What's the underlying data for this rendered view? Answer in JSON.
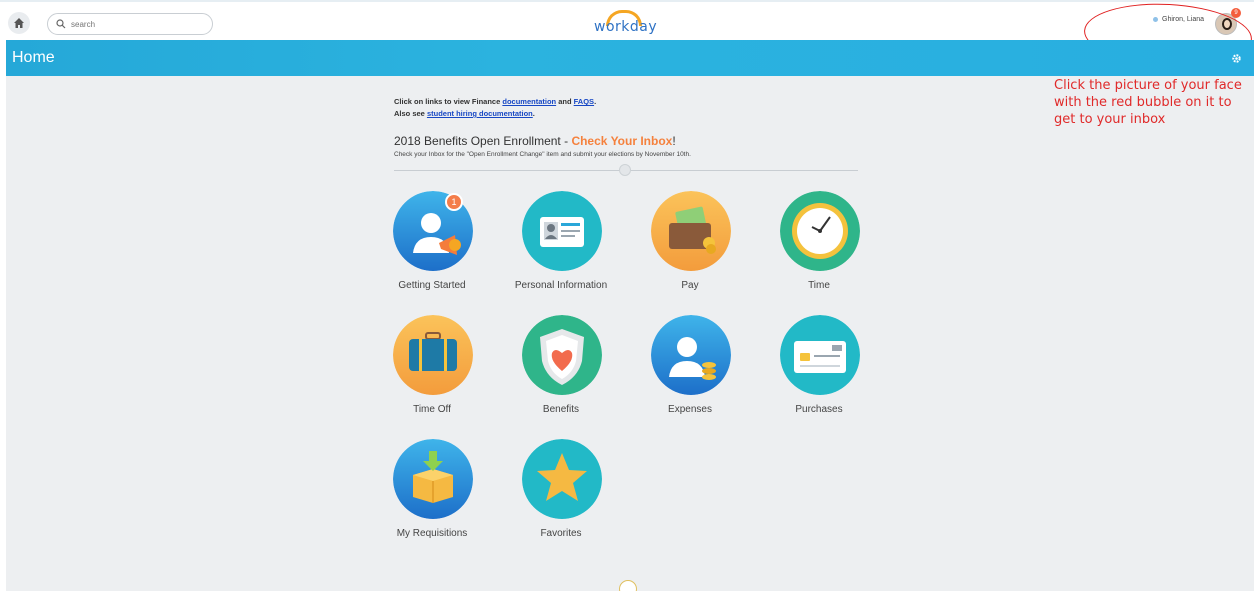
{
  "topbar": {
    "search_placeholder": "search",
    "logo_text": "workday",
    "user_name": "Ghiron, Liana",
    "inbox_badge": "9"
  },
  "banner": {
    "title": "Home"
  },
  "annotation": {
    "text": "Click the picture of your face with the red bubble on it to get to your inbox"
  },
  "intro": {
    "line1_prefix": "Click on links to view Finance ",
    "link_documentation": "documentation",
    "line1_and": " and ",
    "link_faqs": "FAQS",
    "line1_suffix": ".",
    "line2_prefix": "Also see ",
    "link_student_hiring": "student hiring documentation",
    "line2_suffix": "."
  },
  "enrollment": {
    "title_prefix": "2018 Benefits Open Enrollment - ",
    "title_highlight": "Check Your Inbox",
    "title_suffix": "!",
    "subtitle": "Check your Inbox for the \"Open Enrollment Change\" item and submit your elections by November 10th."
  },
  "tiles": [
    {
      "label": "Getting Started",
      "badge": "1"
    },
    {
      "label": "Personal Information"
    },
    {
      "label": "Pay"
    },
    {
      "label": "Time"
    },
    {
      "label": "Time Off"
    },
    {
      "label": "Benefits"
    },
    {
      "label": "Expenses"
    },
    {
      "label": "Purchases"
    },
    {
      "label": "My Requisitions"
    },
    {
      "label": "Favorites"
    }
  ],
  "colors": {
    "banner": "#2bb3df",
    "accent_orange": "#f5813d",
    "annotation_red": "#e02a2a",
    "link_blue": "#1747c4"
  },
  "icons": {
    "home": "home-icon",
    "search": "search-icon",
    "settings": "gear-icon"
  }
}
